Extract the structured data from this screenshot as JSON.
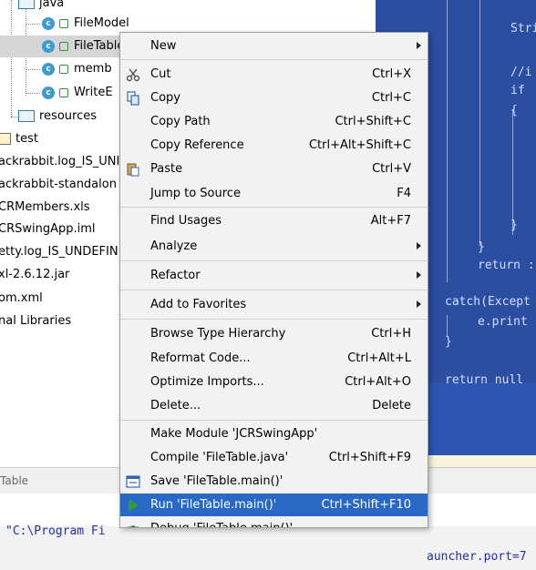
{
  "tree": {
    "items": [
      {
        "label": "java",
        "kind": "folder"
      },
      {
        "label": "FileModel",
        "kind": "class"
      },
      {
        "label": "FileTable",
        "kind": "class"
      },
      {
        "label": "memb",
        "kind": "class"
      },
      {
        "label": "WriteE",
        "kind": "class"
      },
      {
        "label": "resources",
        "kind": "folder"
      },
      {
        "label": "test",
        "kind": "folder"
      },
      {
        "label": "ackrabbit.log_IS_UNI",
        "kind": "file"
      },
      {
        "label": "ackrabbit-standalon",
        "kind": "file"
      },
      {
        "label": "CRMembers.xls",
        "kind": "file"
      },
      {
        "label": "CRSwingApp.iml",
        "kind": "file"
      },
      {
        "label": "etty.log_IS_UNDEFIN",
        "kind": "file"
      },
      {
        "label": "xl-2.6.12.jar",
        "kind": "file"
      },
      {
        "label": "om.xml",
        "kind": "file"
      },
      {
        "label": "nal Libraries",
        "kind": "file"
      }
    ]
  },
  "editor": {
    "lines": [
      {
        "text": "Stri"
      },
      {
        "text": "//i"
      },
      {
        "text": "if"
      },
      {
        "text": "{"
      },
      {
        "text": "}"
      },
      {
        "text": "}"
      },
      {
        "text": "return :"
      },
      {
        "text": "catch(Except"
      },
      {
        "text": "e.print"
      },
      {
        "text": "}"
      },
      {
        "text": "return null"
      }
    ]
  },
  "bottom": {
    "tab_label": "Table",
    "console_text": "\"C:\\Program Fi",
    "console_tail": "auncher.port=7"
  },
  "context_menu": {
    "items": [
      {
        "label": "New",
        "shortcut": "",
        "submenu": true,
        "icon": ""
      },
      {
        "label": "Cut",
        "shortcut": "Ctrl+X",
        "submenu": false,
        "icon": "scissors-icon"
      },
      {
        "label": "Copy",
        "shortcut": "Ctrl+C",
        "submenu": false,
        "icon": "copy-icon"
      },
      {
        "label": "Copy Path",
        "shortcut": "Ctrl+Shift+C",
        "submenu": false,
        "icon": ""
      },
      {
        "label": "Copy Reference",
        "shortcut": "Ctrl+Alt+Shift+C",
        "submenu": false,
        "icon": ""
      },
      {
        "label": "Paste",
        "shortcut": "Ctrl+V",
        "submenu": false,
        "icon": "paste-icon"
      },
      {
        "label": "Jump to Source",
        "shortcut": "F4",
        "submenu": false,
        "icon": ""
      },
      {
        "label": "Find Usages",
        "shortcut": "Alt+F7",
        "submenu": false,
        "icon": ""
      },
      {
        "label": "Analyze",
        "shortcut": "",
        "submenu": true,
        "icon": ""
      },
      {
        "label": "Refactor",
        "shortcut": "",
        "submenu": true,
        "icon": ""
      },
      {
        "label": "Add to Favorites",
        "shortcut": "",
        "submenu": true,
        "icon": ""
      },
      {
        "label": "Browse Type Hierarchy",
        "shortcut": "Ctrl+H",
        "submenu": false,
        "icon": ""
      },
      {
        "label": "Reformat Code...",
        "shortcut": "Ctrl+Alt+L",
        "submenu": false,
        "icon": ""
      },
      {
        "label": "Optimize Imports...",
        "shortcut": "Ctrl+Alt+O",
        "submenu": false,
        "icon": ""
      },
      {
        "label": "Delete...",
        "shortcut": "Delete",
        "submenu": false,
        "icon": ""
      },
      {
        "label": "Make Module 'JCRSwingApp'",
        "shortcut": "",
        "submenu": false,
        "icon": ""
      },
      {
        "label": "Compile 'FileTable.java'",
        "shortcut": "Ctrl+Shift+F9",
        "submenu": false,
        "icon": ""
      },
      {
        "label": "Save 'FileTable.main()'",
        "shortcut": "",
        "submenu": false,
        "icon": "save-config-icon"
      },
      {
        "label": "Run 'FileTable.main()'",
        "shortcut": "Ctrl+Shift+F10",
        "submenu": false,
        "icon": "run-icon",
        "highlighted": true
      },
      {
        "label": "Debug 'FileTable.main()'",
        "shortcut": "",
        "submenu": false,
        "icon": "debug-icon"
      }
    ]
  },
  "colors": {
    "menu_highlight": "#2a68c6",
    "editor_bg": "#2b4ea0",
    "run_icon": "#2e9e3a"
  }
}
